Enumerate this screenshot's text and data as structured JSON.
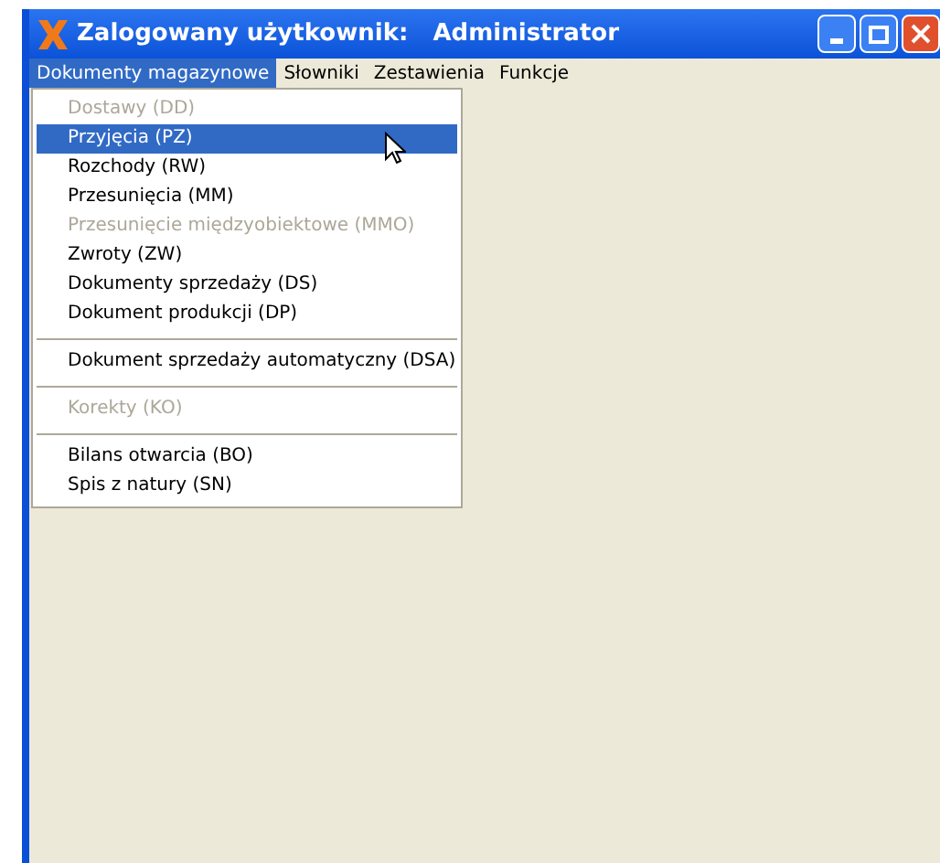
{
  "window": {
    "title": "Zalogowany użytkownik:   Administrator"
  },
  "menu_bar": [
    {
      "label": "Dokumenty magazynowe",
      "selected": true
    },
    {
      "label": "Słowniki",
      "selected": false
    },
    {
      "label": "Zestawienia",
      "selected": false
    },
    {
      "label": "Funkcje",
      "selected": false
    }
  ],
  "dropdown": [
    {
      "kind": "item",
      "label": "Dostawy (DD)",
      "disabled": true,
      "selected": false
    },
    {
      "kind": "item",
      "label": "Przyjęcia (PZ)",
      "disabled": false,
      "selected": true
    },
    {
      "kind": "item",
      "label": "Rozchody (RW)",
      "disabled": false,
      "selected": false
    },
    {
      "kind": "item",
      "label": "Przesunięcia (MM)",
      "disabled": false,
      "selected": false
    },
    {
      "kind": "item",
      "label": "Przesunięcie międzyobiektowe (MMO)",
      "disabled": true,
      "selected": false
    },
    {
      "kind": "item",
      "label": "Zwroty (ZW)",
      "disabled": false,
      "selected": false
    },
    {
      "kind": "item",
      "label": "Dokumenty sprzedaży (DS)",
      "disabled": false,
      "selected": false
    },
    {
      "kind": "item",
      "label": "Dokument produkcji (DP)",
      "disabled": false,
      "selected": false
    },
    {
      "kind": "separator"
    },
    {
      "kind": "item",
      "label": "Dokument sprzedaży automatyczny (DSA)",
      "disabled": false,
      "selected": false
    },
    {
      "kind": "separator"
    },
    {
      "kind": "item",
      "label": "Korekty (KO)",
      "disabled": true,
      "selected": false
    },
    {
      "kind": "separator"
    },
    {
      "kind": "item",
      "label": "Bilans otwarcia (BO)",
      "disabled": false,
      "selected": false
    },
    {
      "kind": "item",
      "label": "Spis z natury (SN)",
      "disabled": false,
      "selected": false
    }
  ]
}
